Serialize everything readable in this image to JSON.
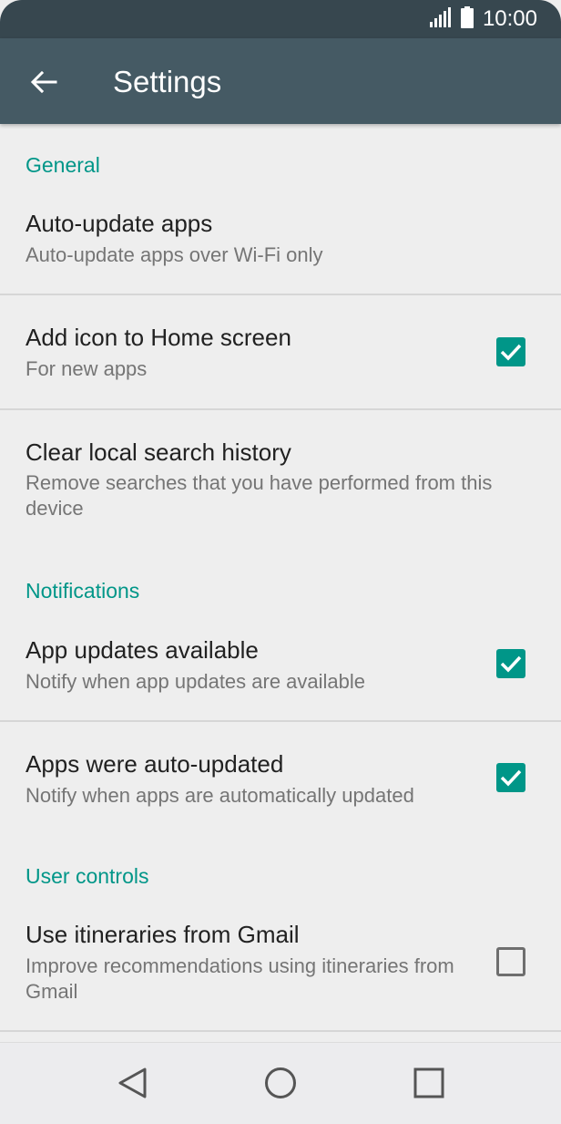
{
  "status_bar": {
    "time": "10:00",
    "signal_icon": "signal-icon",
    "battery_icon": "battery-icon"
  },
  "app_bar": {
    "title": "Settings",
    "back_icon": "arrow-back-icon"
  },
  "sections": {
    "general": "General",
    "notifications": "Notifications",
    "user_controls": "User controls"
  },
  "items": {
    "auto_update": {
      "title": "Auto-update apps",
      "subtitle": "Auto-update apps over Wi-Fi only"
    },
    "add_icon": {
      "title": "Add icon to Home screen",
      "subtitle": "For new apps",
      "checked": true
    },
    "clear_history": {
      "title": "Clear local search history",
      "subtitle": "Remove searches that you have performed from this device"
    },
    "app_updates": {
      "title": "App updates available",
      "subtitle": "Notify when app updates are available",
      "checked": true
    },
    "auto_updated": {
      "title": "Apps were auto-updated",
      "subtitle": "Notify when apps are automatically updated",
      "checked": true
    },
    "itineraries": {
      "title": "Use itineraries from Gmail",
      "subtitle": "Improve recommendations using itineraries from Gmail",
      "checked": false
    }
  },
  "nav_bar": {
    "back": "nav-back-icon",
    "home": "nav-home-icon",
    "recents": "nav-recents-icon"
  },
  "colors": {
    "accent": "#009688",
    "app_bar": "#455a64",
    "status_bar": "#37474f"
  }
}
